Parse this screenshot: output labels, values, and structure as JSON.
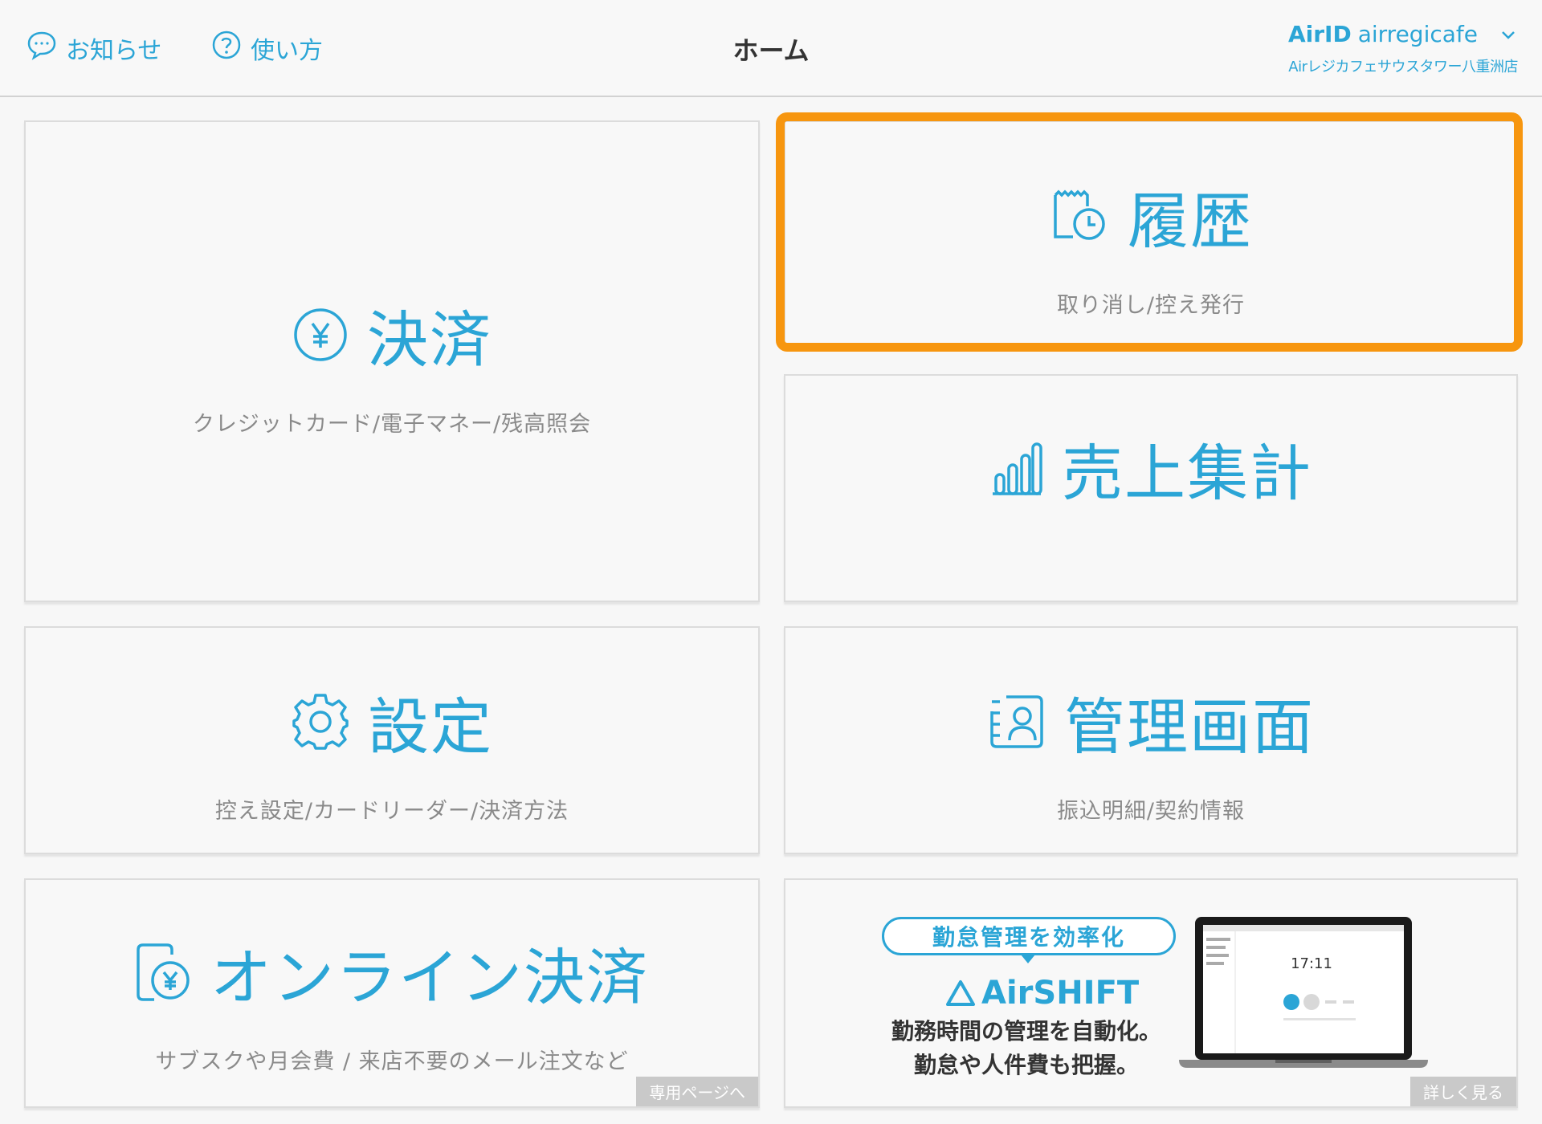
{
  "header": {
    "notice_label": "お知らせ",
    "help_label": "使い方",
    "title": "ホーム",
    "airid_label": "AirID",
    "account_id": "airregicafe",
    "store_name": "Airレジカフェサウスタワー八重洲店"
  },
  "tiles": {
    "payment": {
      "title": "決済",
      "subtitle": "クレジットカード/電子マネー/残高照会"
    },
    "history": {
      "title": "履歴",
      "subtitle": "取り消し/控え発行"
    },
    "sales": {
      "title": "売上集計"
    },
    "settings": {
      "title": "設定",
      "subtitle": "控え設定/カードリーダー/決済方法"
    },
    "admin": {
      "title": "管理画面",
      "subtitle": "振込明細/契約情報"
    },
    "online": {
      "title": "オンライン決済",
      "subtitle": "サブスクや月会費 / 来店不要のメール注文など",
      "tag": "専用ページへ"
    }
  },
  "banner": {
    "pill": "勤怠管理を効率化",
    "logo": "AirSHIFT",
    "line1": "勤務時間の管理を自動化。",
    "line2": "勤怠や人件費も把握。",
    "screen_time": "17:11",
    "tag": "詳しく見る"
  },
  "colors": {
    "accent": "#2ba5d6",
    "highlight": "#f7960f",
    "subtext": "#8a8a8a",
    "background": "#f7f7f7"
  },
  "icons": {
    "notice": "speech-bubble-icon",
    "help": "question-circle-icon",
    "payment": "yen-circle-icon",
    "history": "receipt-clock-icon",
    "sales": "bar-chart-icon",
    "settings": "gear-icon",
    "admin": "user-list-icon",
    "online": "phone-yen-icon"
  }
}
